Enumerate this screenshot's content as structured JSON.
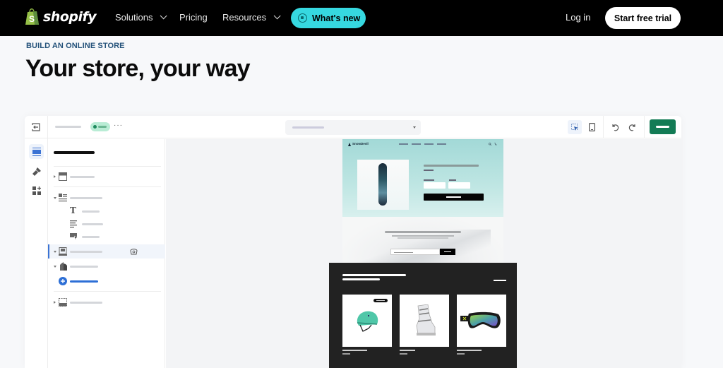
{
  "nav": {
    "brand": "shopify",
    "items": [
      {
        "label": "Solutions",
        "has_dropdown": true
      },
      {
        "label": "Pricing",
        "has_dropdown": false
      },
      {
        "label": "Resources",
        "has_dropdown": true
      }
    ],
    "whats_new": "What's new",
    "login": "Log in",
    "cta": "Start free trial"
  },
  "hero": {
    "eyebrow": "BUILD AN ONLINE STORE",
    "title": "Your store, your way"
  },
  "editor": {
    "topbar": {
      "exit_icon": "exit-icon",
      "status_color": "#1e8a5e",
      "more": "···",
      "toolbar_icons": [
        "inspector-icon",
        "mobile-preview-icon",
        "undo-icon",
        "redo-icon"
      ],
      "save_color": "#137b55"
    },
    "rail_icons": [
      "sections-icon",
      "theme-settings-icon",
      "app-blocks-icon"
    ],
    "tree": [
      {
        "icon": "header-icon",
        "expanded": false,
        "level": 0
      },
      {
        "icon": "image-banner-icon",
        "expanded": true,
        "level": 0
      },
      {
        "icon": "heading-icon",
        "level": 1
      },
      {
        "icon": "text-icon",
        "level": 1
      },
      {
        "icon": "button-icon",
        "level": 1
      },
      {
        "icon": "featured-product-icon",
        "expanded": true,
        "level": 0,
        "active": true
      },
      {
        "icon": "product-icon",
        "expanded": true,
        "level": 0
      },
      {
        "icon": "add-block-icon",
        "level": 1,
        "accent": true
      },
      {
        "icon": "footer-icon",
        "expanded": false,
        "level": 0
      }
    ],
    "preview": {
      "store_name": "SnowDevil",
      "sections": [
        "featured-product",
        "newsletter",
        "featured-collection"
      ],
      "collection_products": [
        "helmet",
        "ski-boot",
        "goggles"
      ]
    }
  },
  "colors": {
    "accent_cyan": "#36d8e0",
    "eyebrow": "#24527a",
    "editor_active": "#3b73d4"
  }
}
